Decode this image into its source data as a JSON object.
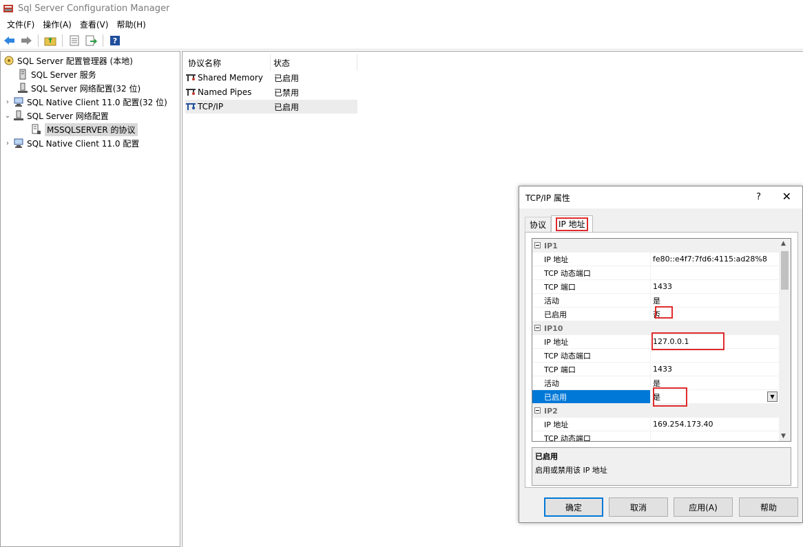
{
  "window": {
    "title": "Sql Server Configuration Manager"
  },
  "menu": [
    "文件(F)",
    "操作(A)",
    "查看(V)",
    "帮助(H)"
  ],
  "toolbar": {
    "back_icon": "arrow-left-icon",
    "forward_icon": "arrow-right-icon",
    "up_icon": "up-folder-icon",
    "properties_icon": "properties-icon",
    "export_icon": "export-icon",
    "help_icon": "help-icon"
  },
  "tree": [
    {
      "label": "SQL Server 配置管理器 (本地)",
      "level": 0,
      "expander": "",
      "icon": "config-manager-icon"
    },
    {
      "label": "SQL Server 服务",
      "level": 1,
      "expander": "",
      "icon": "services-icon"
    },
    {
      "label": "SQL Server 网络配置(32 位)",
      "level": 1,
      "expander": "",
      "icon": "network-icon"
    },
    {
      "label": "SQL Native Client 11.0 配置(32 位)",
      "level": 1,
      "expander": "›",
      "icon": "client-icon"
    },
    {
      "label": "SQL Server 网络配置",
      "level": 1,
      "expander": "⌄",
      "icon": "network-icon"
    },
    {
      "label": "MSSQLSERVER 的协议",
      "level": 2,
      "expander": "",
      "icon": "protocol-folder-icon",
      "selected": true
    },
    {
      "label": "SQL Native Client 11.0 配置",
      "level": 1,
      "expander": "›",
      "icon": "client-icon"
    }
  ],
  "list": {
    "headers": [
      "协议名称",
      "状态"
    ],
    "rows": [
      {
        "name": "Shared Memory",
        "status": "已启用"
      },
      {
        "name": "Named Pipes",
        "status": "已禁用"
      },
      {
        "name": "TCP/IP",
        "status": "已启用"
      }
    ]
  },
  "dialog": {
    "title": "TCP/IP 属性",
    "help": "?",
    "close": "✕",
    "tabs": [
      "协议",
      "IP 地址"
    ],
    "grid": [
      {
        "type": "cat",
        "name": "IP1"
      },
      {
        "name": "IP 地址",
        "value": "fe80::e4f7:7fd6:4115:ad28%8"
      },
      {
        "name": "TCP 动态端口",
        "value": ""
      },
      {
        "name": "TCP 端口",
        "value": "1433"
      },
      {
        "name": "活动",
        "value": "是"
      },
      {
        "name": "已启用",
        "value": "否"
      },
      {
        "type": "cat",
        "name": "IP10"
      },
      {
        "name": "IP 地址",
        "value": "127.0.0.1"
      },
      {
        "name": "TCP 动态端口",
        "value": ""
      },
      {
        "name": "TCP 端口",
        "value": "1433"
      },
      {
        "name": "活动",
        "value": "是"
      },
      {
        "name": "已启用",
        "value": "是",
        "selected": true
      },
      {
        "type": "cat",
        "name": "IP2"
      },
      {
        "name": "IP 地址",
        "value": "169.254.173.40"
      },
      {
        "name": "TCP 动态端口",
        "value": ""
      }
    ],
    "description": {
      "title": "已启用",
      "text": "启用或禁用该 IP 地址"
    },
    "buttons": [
      "确定",
      "取消",
      "应用(A)",
      "帮助"
    ]
  }
}
